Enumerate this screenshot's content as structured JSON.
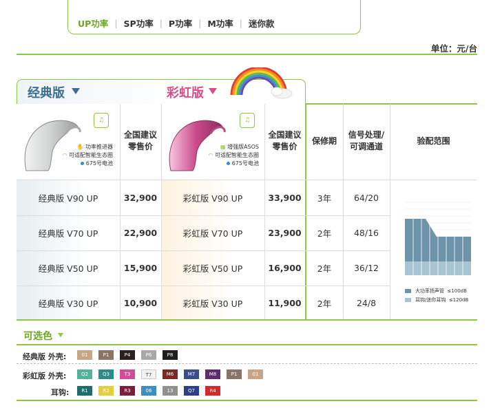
{
  "tabs": [
    {
      "label": "UP功率",
      "active": true
    },
    {
      "label": "SP功率",
      "active": false
    },
    {
      "label": "P功率",
      "active": false
    },
    {
      "label": "M功率",
      "active": false
    },
    {
      "label": "迷你款",
      "active": false
    }
  ],
  "unit": "单位：元/台",
  "versions": {
    "classic": "经典版",
    "rainbow": "彩虹版"
  },
  "classic_features": {
    "f1": "功率推进器",
    "f2": "可适配智能生态圈",
    "f3": "675号电池"
  },
  "rainbow_features": {
    "f1": "增强版ASOS",
    "f2": "可适配智能生态圈",
    "f3": "675号电池"
  },
  "headers": {
    "price1": "全国建议零售价",
    "price2": "全国建议零售价",
    "warranty": "保修期",
    "channels": "信号处理/可调通道",
    "fitting": "验配范围"
  },
  "rows": [
    {
      "classic": "经典版 V90 UP",
      "classic_price": "32,900",
      "rainbow": "彩虹版 V90 UP",
      "rainbow_price": "33,900",
      "warranty": "3年",
      "channels": "64/20"
    },
    {
      "classic": "经典版 V70 UP",
      "classic_price": "22,900",
      "rainbow": "彩虹版 V70 UP",
      "rainbow_price": "23,900",
      "warranty": "2年",
      "channels": "48/16"
    },
    {
      "classic": "经典版 V50 UP",
      "classic_price": "15,900",
      "rainbow": "彩虹版 V50 UP",
      "rainbow_price": "16,900",
      "warranty": "2年",
      "channels": "36/12"
    },
    {
      "classic": "经典版 V30 UP",
      "classic_price": "10,900",
      "rainbow": "彩虹版 V30 UP",
      "rainbow_price": "11,900",
      "warranty": "2年",
      "channels": "24/8"
    }
  ],
  "fitting_legend": {
    "a": "大功率扬声管",
    "a_val": "≤100dB",
    "b": "耳钩/迷你耳钩",
    "b_val": "≤120dB"
  },
  "colors_title": "可选色",
  "colors": {
    "classic_label": "经典版",
    "shell_label": "外壳:",
    "rainbow_label": "彩虹版",
    "hook_label": "耳钩:",
    "classic_shell": [
      {
        "code": "01",
        "color": "#c8a488"
      },
      {
        "code": "P1",
        "color": "#8a7468"
      },
      {
        "code": "P4",
        "color": "#2b2020"
      },
      {
        "code": "P6",
        "color": "#a8a8a8"
      },
      {
        "code": "P8",
        "color": "#1e1e1e"
      }
    ],
    "rainbow_shell": [
      {
        "code": "Q2",
        "color": "#55b29a"
      },
      {
        "code": "Q3",
        "color": "#2e8a86"
      },
      {
        "code": "T3",
        "color": "#d24c99"
      },
      {
        "code": "T7",
        "color": "#f2f2f2"
      },
      {
        "code": "M6",
        "color": "#7a2a22"
      },
      {
        "code": "M7",
        "color": "#3b4d8a"
      },
      {
        "code": "M8",
        "color": "#5b2d6e"
      },
      {
        "code": "P1",
        "color": "#8a7468"
      },
      {
        "code": "01",
        "color": "#c8a488"
      }
    ],
    "rainbow_hook": [
      {
        "code": "R1",
        "color": "#1f6e6e"
      },
      {
        "code": "R2",
        "color": "#e4cf3d"
      },
      {
        "code": "R3",
        "color": "#7d1f3a"
      },
      {
        "code": "06",
        "color": "#3d8fc0"
      },
      {
        "code": "13",
        "color": "#8f8f8f"
      },
      {
        "code": "Q7",
        "color": "#2d3f86"
      },
      {
        "code": "R4",
        "color": "#d32a2a"
      }
    ]
  }
}
